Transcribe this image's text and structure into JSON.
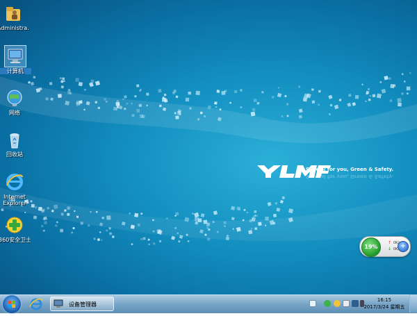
{
  "desktop": {
    "icons": [
      {
        "label": "Administra..."
      },
      {
        "label": "计算机"
      },
      {
        "label": "网络"
      },
      {
        "label": "回收站"
      },
      {
        "label": "Internet\nExplorer"
      },
      {
        "label": "360安全卫士"
      }
    ],
    "wallpaper_tagline": "Special for you, Green & Safety.",
    "wallpaper_logo": "YLMF"
  },
  "net_widget": {
    "percent": "19%",
    "upload": "0K/s",
    "download": "0K/s"
  },
  "taskbar": {
    "task_label": "设备管理器",
    "time": "16:15",
    "date": "2017/3/24 星期五"
  },
  "colors": {
    "wallpaper": "#138fc0",
    "taskbar": "#7ba7c8",
    "widget_green": "#1f9b2b"
  }
}
